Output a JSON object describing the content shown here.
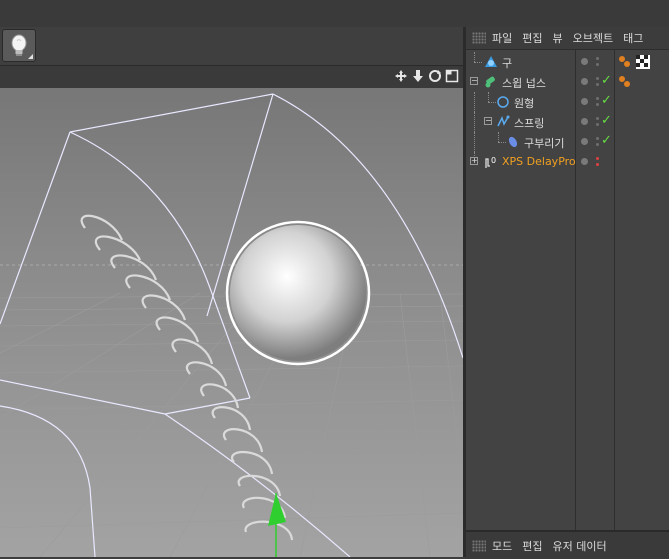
{
  "objects_menu": {
    "items": [
      "파일",
      "편집",
      "뷰",
      "오브젝트",
      "태그"
    ]
  },
  "objects": [
    {
      "name": "구",
      "icon": "sphere-icon",
      "has_check": false,
      "has_tag": true
    },
    {
      "name": "스윕 넙스",
      "icon": "sweep-nurbs-icon",
      "has_check": true,
      "has_tag": true
    },
    {
      "name": "원형",
      "icon": "circle-spline-icon",
      "has_check": true,
      "has_tag": false
    },
    {
      "name": "스프링",
      "icon": "spring-spline-icon",
      "has_check": true,
      "has_tag": false
    },
    {
      "name": "구부리기",
      "icon": "bend-deformer-icon",
      "has_check": true,
      "has_tag": false
    },
    {
      "name": "XPS DelayPro",
      "icon": "xps-delaypro-icon",
      "has_check": false,
      "has_tag": false
    }
  ],
  "attributes_menu": {
    "items": [
      "모드",
      "편집",
      "유저 데이터"
    ]
  },
  "colors": {
    "check": "#66dd44",
    "xps_label": "#f0a020",
    "sphere_icon": "#3a9be0",
    "tag": "#e08020",
    "red_dot": "#e04040"
  }
}
